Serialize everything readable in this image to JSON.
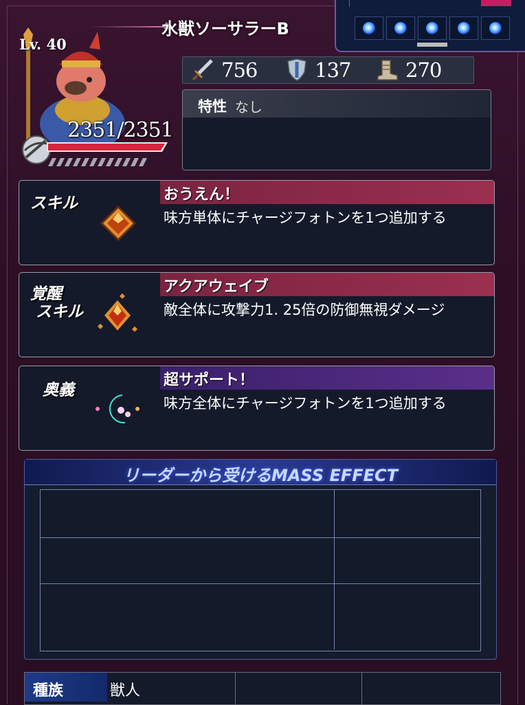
{
  "unit": {
    "name": "水獣ソーサラーB",
    "level": "Lv. 40",
    "hp": "2351/2351"
  },
  "stats": {
    "attack": "756",
    "defense": "137",
    "speed": "270"
  },
  "trait": {
    "label": "特性",
    "value": "なし"
  },
  "skill": {
    "tag": "スキル",
    "name": "おうえん！",
    "desc": "味方単体にチャージフォトンを1つ追加する"
  },
  "awakened": {
    "tag_line1": "覚醒",
    "tag_line2": "スキル",
    "name": "アクアウェイブ",
    "desc": "敵全体に攻撃力1. 25倍の防御無視ダメージ"
  },
  "ougi": {
    "tag": "奥義",
    "name": "超サポート！",
    "desc": "味方全体にチャージフォトンを1つ追加する"
  },
  "mass_effect": {
    "title": "リーダーから受けるMASS EFFECT"
  },
  "race": {
    "label": "種族",
    "value": "獣人"
  },
  "colors": {
    "skill_bar": "#8a2a4a",
    "ougi_bar": "#4a2a7a",
    "orb": "#3a8aff"
  }
}
